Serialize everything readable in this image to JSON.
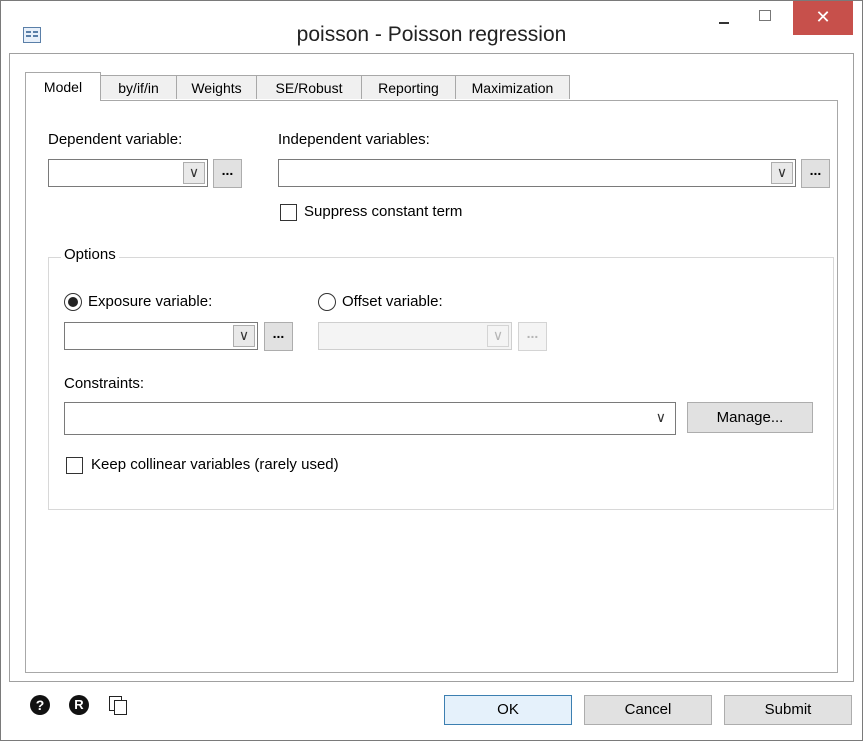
{
  "window": {
    "title": "poisson - Poisson regression",
    "app_icon": "dialog-icon",
    "controls": {
      "minimize": "minimize-icon",
      "maximize": "maximize-icon",
      "close": "✕"
    }
  },
  "tabs": [
    {
      "label": "Model",
      "active": true
    },
    {
      "label": "by/if/in",
      "active": false
    },
    {
      "label": "Weights",
      "active": false
    },
    {
      "label": "SE/Robust",
      "active": false
    },
    {
      "label": "Reporting",
      "active": false
    },
    {
      "label": "Maximization",
      "active": false
    }
  ],
  "model": {
    "dependent_label": "Dependent variable:",
    "dependent_value": "",
    "independent_label": "Independent variables:",
    "independent_value": "",
    "browse_label": "...",
    "chevron": "∨",
    "suppress_constant_label": "Suppress constant term",
    "suppress_constant_checked": false
  },
  "options": {
    "group_title": "Options",
    "exposure_label": "Exposure variable:",
    "exposure_selected": true,
    "exposure_value": "",
    "offset_label": "Offset variable:",
    "offset_selected": false,
    "offset_value": "",
    "constraints_label": "Constraints:",
    "constraints_value": "",
    "manage_label": "Manage...",
    "collinear_label": "Keep collinear variables (rarely used)",
    "collinear_checked": false
  },
  "footer": {
    "help_icon": "help-icon",
    "reset_icon": "reset-icon",
    "copy_icon": "copy-command-icon",
    "ok_label": "OK",
    "cancel_label": "Cancel",
    "submit_label": "Submit"
  }
}
